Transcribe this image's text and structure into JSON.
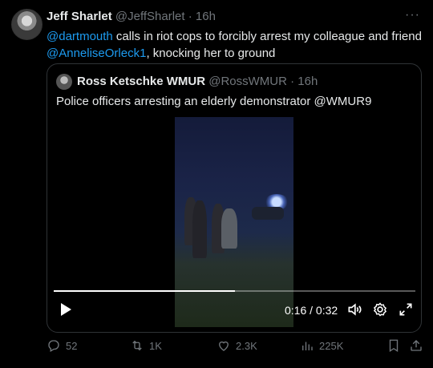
{
  "tweet": {
    "author_name": "Jeff Sharlet",
    "author_handle": "@JeffSharlet",
    "separator": "·",
    "time": "16h",
    "more": "···",
    "text_mention1": "@dartmouth",
    "text_part1": " calls in riot cops to forcibly arrest my colleague and friend ",
    "text_mention2": "@AnneliseOrleck1",
    "text_part2": ", knocking her to ground"
  },
  "quote": {
    "author_name": "Ross Ketschke WMUR",
    "author_handle": "@RossWMUR",
    "separator": "·",
    "time": "16h",
    "text": "Police officers arresting an elderly demonstrator @WMUR9"
  },
  "video": {
    "time_display": "0:16 / 0:32",
    "progress": 0.5,
    "colors": {
      "track": "#ffffff59",
      "fill": "#ffffff"
    }
  },
  "actions": {
    "replies": "52",
    "reposts": "1K",
    "likes": "2.3K",
    "views": "225K",
    "icons": [
      "reply-icon",
      "repost-icon",
      "like-icon",
      "views-icon",
      "bookmark-icon",
      "share-icon"
    ]
  },
  "colors": {
    "link": "#1d9bf0",
    "muted": "#71767b",
    "text": "#e7e9ea",
    "border": "#2f3336"
  }
}
